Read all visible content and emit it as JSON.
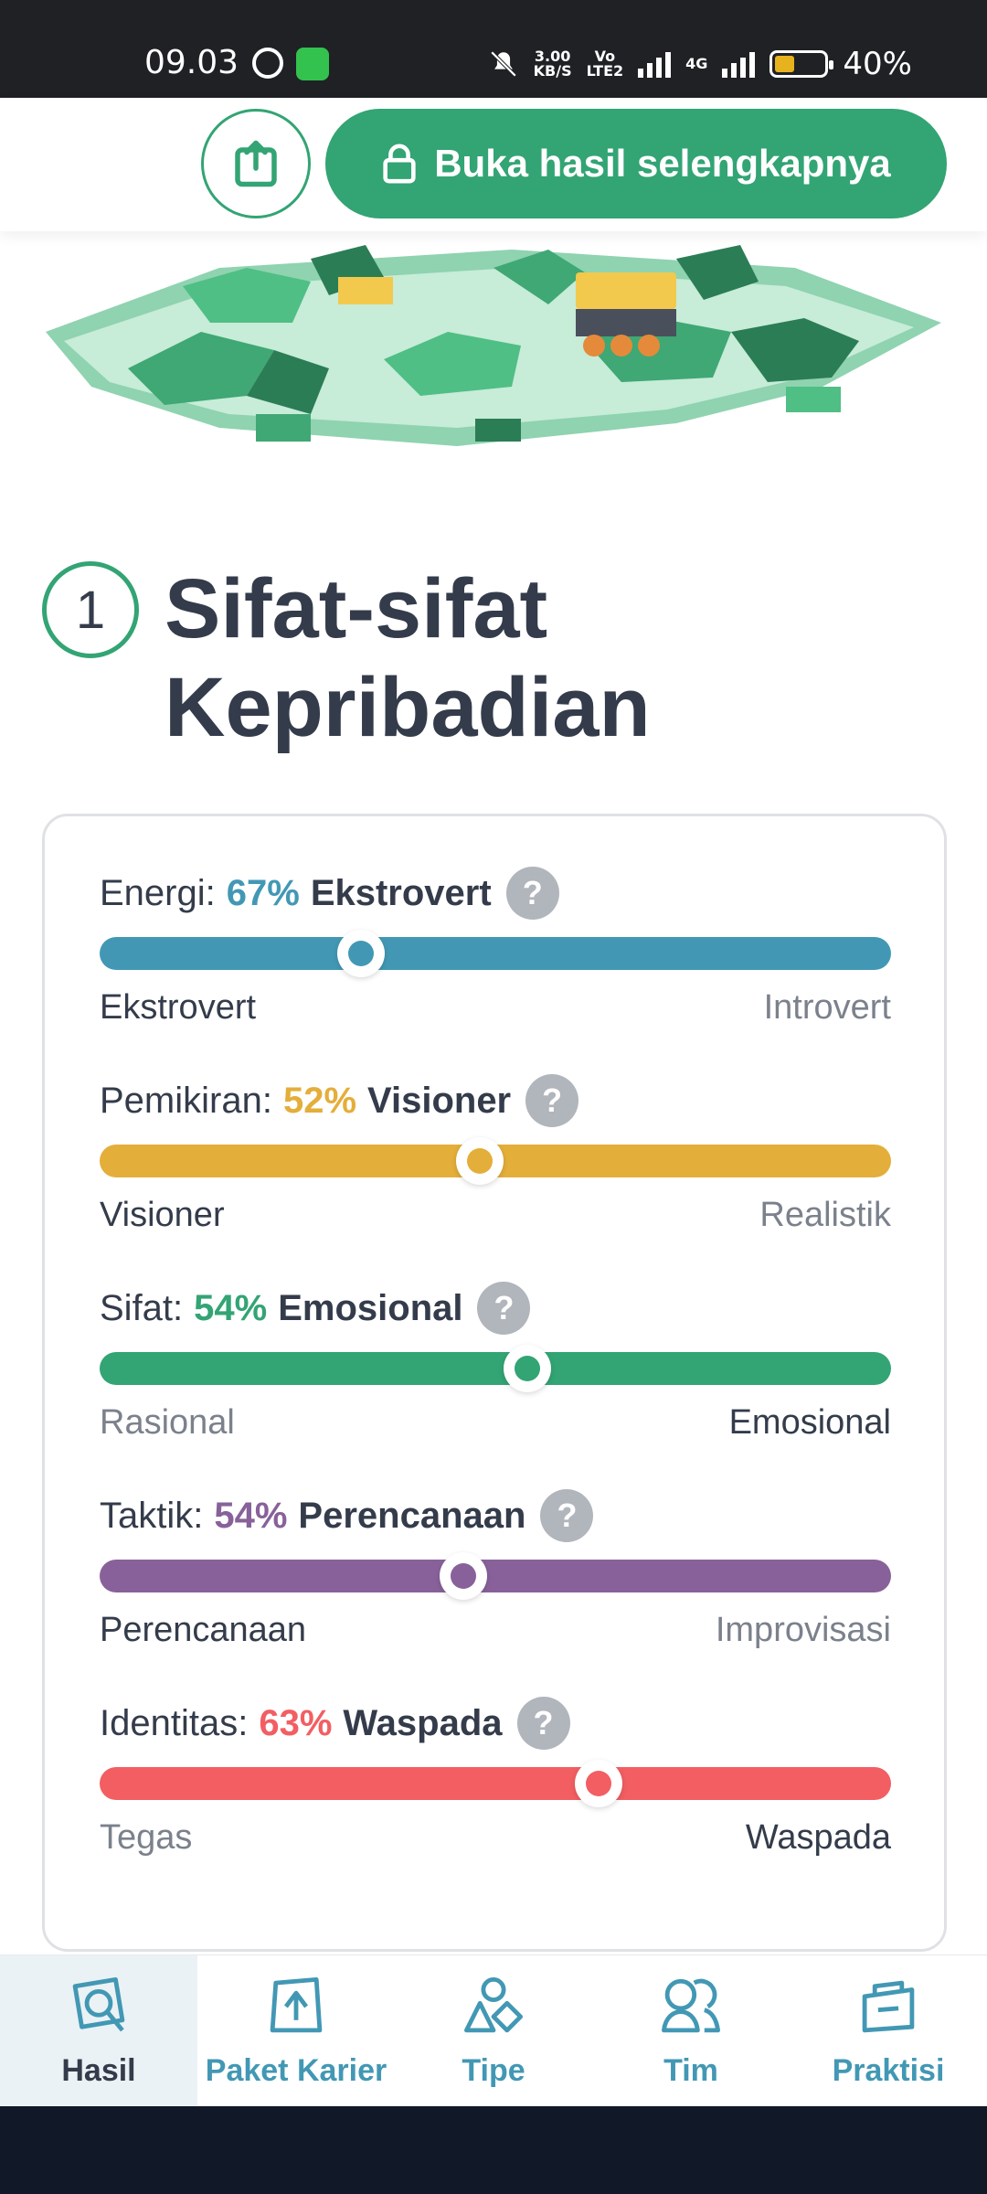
{
  "status_bar": {
    "time": "09.03",
    "speed_value": "3.00",
    "speed_unit": "KB/S",
    "volte": "Vo",
    "volte_sub": "LTE2",
    "network": "4G",
    "battery": "40%",
    "battery_color": "#e6b31e"
  },
  "topbar": {
    "share_icon": "share-icon",
    "unlock_label": "Buka hasil selengkapnya",
    "unlock_icon": "lock-icon",
    "accent": "#33a474"
  },
  "section": {
    "number": "1",
    "title_line1": "Sifat-sifat",
    "title_line2": "Kepribadian"
  },
  "traits": [
    {
      "label": "Energi:",
      "percent": "67%",
      "type": "Ekstrovert",
      "left": "Ekstrovert",
      "right": "Introvert",
      "active": "left",
      "color": "#4298b4",
      "level": 0.33
    },
    {
      "label": "Pemikiran:",
      "percent": "52%",
      "type": "Visioner",
      "left": "Visioner",
      "right": "Realistik",
      "active": "left",
      "color": "#e4ae3a",
      "level": 0.48
    },
    {
      "label": "Sifat:",
      "percent": "54%",
      "type": "Emosional",
      "left": "Rasional",
      "right": "Emosional",
      "active": "right",
      "color": "#33a474",
      "level": 0.54
    },
    {
      "label": "Taktik:",
      "percent": "54%",
      "type": "Perencanaan",
      "left": "Perencanaan",
      "right": "Improvisasi",
      "active": "left",
      "color": "#88619a",
      "level": 0.46
    },
    {
      "label": "Identitas:",
      "percent": "63%",
      "type": "Waspada",
      "left": "Tegas",
      "right": "Waspada",
      "active": "right",
      "color": "#f25e62",
      "level": 0.63
    }
  ],
  "help_symbol": "?",
  "bottom_nav": [
    {
      "label": "Hasil",
      "icon": "results-icon",
      "active": true
    },
    {
      "label": "Paket Karier",
      "icon": "career-icon",
      "active": false
    },
    {
      "label": "Tipe",
      "icon": "types-icon",
      "active": false
    },
    {
      "label": "Tim",
      "icon": "team-icon",
      "active": false
    },
    {
      "label": "Praktisi",
      "icon": "professionals-icon",
      "active": false
    }
  ]
}
